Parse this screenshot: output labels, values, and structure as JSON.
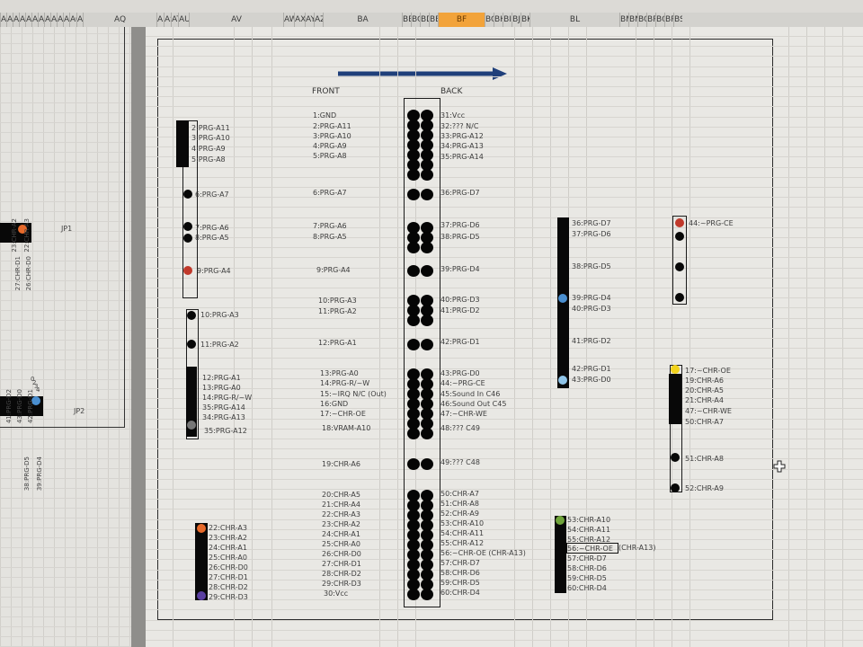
{
  "column_headers": [
    {
      "label": "AD"
    },
    {
      "label": "AE"
    },
    {
      "label": "AF"
    },
    {
      "label": "AG"
    },
    {
      "label": "AH"
    },
    {
      "label": "AI"
    },
    {
      "label": "AJ"
    },
    {
      "label": "AK"
    },
    {
      "label": "AL"
    },
    {
      "label": "AM"
    },
    {
      "label": "AN"
    },
    {
      "label": "AO"
    },
    {
      "label": "AP"
    },
    {
      "label": "AQ"
    },
    {
      "label": "AR"
    },
    {
      "label": "AS"
    },
    {
      "label": "AT"
    },
    {
      "label": "AU"
    },
    {
      "label": "AV"
    },
    {
      "label": "AW"
    },
    {
      "label": "AX"
    },
    {
      "label": "AY"
    },
    {
      "label": "AZ"
    },
    {
      "label": "BA"
    },
    {
      "label": "BB"
    },
    {
      "label": "BC"
    },
    {
      "label": "BD"
    },
    {
      "label": "BE"
    },
    {
      "label": "BF"
    },
    {
      "label": "BG"
    },
    {
      "label": "BH"
    },
    {
      "label": "BI"
    },
    {
      "label": "BJ"
    },
    {
      "label": "BK"
    },
    {
      "label": "BL"
    },
    {
      "label": "BM"
    },
    {
      "label": "BN"
    },
    {
      "label": "BO"
    },
    {
      "label": "BP"
    },
    {
      "label": "BQ"
    },
    {
      "label": "BR"
    },
    {
      "label": "BS"
    }
  ],
  "selected_column": "BF",
  "left_pane": {
    "jp1": "JP1",
    "jp2": "JP2",
    "rot_labels": [
      "22:CHR-A3",
      "23:CHR-A2",
      "26:CHR-D0",
      "27:CHR-D1",
      "42:PRG-D1",
      "43:PRG-D0",
      "41:PRG-D2",
      "38:PRG-D5",
      "39:PRG-D4"
    ],
    "digits": [
      "0",
      "2",
      "3",
      "4"
    ]
  },
  "main": {
    "front_header": "FRONT",
    "back_header": "BACK",
    "left_connector_labels": [
      "2:PRG-A11",
      "3:PRG-A10",
      "4:PRG-A9",
      "5:PRG-A8",
      "6:PRG-A7",
      "7:PRG-A6",
      "8:PRG-A5",
      "9:PRG-A4",
      "10:PRG-A3",
      "11:PRG-A2",
      "12:PRG-A1",
      "13:PRG-A0",
      "14:PRG-R/~W",
      "35:PRG-A14",
      "34:PRG-A13",
      "35:PRG-A12",
      "22:CHR-A3",
      "23:CHR-A2",
      "24:CHR-A1",
      "25:CHR-A0",
      "26:CHR-D0",
      "27:CHR-D1",
      "28:CHR-D2",
      "29:CHR-D3"
    ],
    "front_labels": [
      "1:GND",
      "2:PRG-A11",
      "3:PRG-A10",
      "4:PRG-A9",
      "5:PRG-A8",
      "6:PRG-A7",
      "7:PRG-A6",
      "8:PRG-A5",
      "9:PRG-A4",
      "10:PRG-A3",
      "11:PRG-A2",
      "12:PRG-A1",
      "13:PRG-A0",
      "14:PRG-R/~W",
      "15:~IRQ N/C (Out)",
      "16:GND",
      "17:~CHR-OE",
      "18:VRAM-A10",
      "19:CHR-A6",
      "20:CHR-A5",
      "21:CHR-A4",
      "22:CHR-A3",
      "23:CHR-A2",
      "24:CHR-A1",
      "25:CHR-A0",
      "26:CHR-D0",
      "27:CHR-D1",
      "28:CHR-D2",
      "29:CHR-D3",
      "30:Vcc"
    ],
    "back_labels": [
      "31:Vcc",
      "32:??? N/C",
      "33:PRG-A12",
      "34:PRG-A13",
      "35:PRG-A14",
      "36:PRG-D7",
      "37:PRG-D6",
      "38:PRG-D5",
      "39:PRG-D4",
      "40:PRG-D3",
      "41:PRG-D2",
      "42:PRG-D1",
      "43:PRG-D0",
      "44:~PRG-CE",
      "45:Sound In C46",
      "46:Sound Out C45",
      "47:~CHR-WE",
      "48:??? C49",
      "49:??? C48",
      "50:CHR-A7",
      "51:CHR-A8",
      "52:CHR-A9",
      "53:CHR-A10",
      "54:CHR-A11",
      "55:CHR-A12",
      "56:~CHR-OE (CHR-A13)",
      "57:CHR-D7",
      "58:CHR-D6",
      "59:CHR-D5",
      "60:CHR-D4"
    ],
    "right1_labels": [
      "36:PRG-D7",
      "37:PRG-D6",
      "38:PRG-D5",
      "39:PRG-D4",
      "40:PRG-D3",
      "41:PRG-D2",
      "42:PRG-D1",
      "43:PRG-D0"
    ],
    "right1b_labels": [
      "53:CHR-A10",
      "54:CHR-A11",
      "55:CHR-A12",
      "56:~CHR-OE",
      "57:CHR-D7",
      "58:CHR-D6",
      "59:CHR-D5",
      "60:CHR-D4"
    ],
    "right1b_extra": "(CHR-A13)",
    "right2_labels": [
      "44:~PRG-CE"
    ],
    "right2b_labels": [
      "17:~CHR-OE",
      "19:CHR-A6",
      "20:CHR-A5",
      "21:CHR-A4",
      "47:~CHR-WE",
      "50:CHR-A7",
      "51:CHR-A8",
      "52:CHR-A9"
    ]
  },
  "colors": {
    "pin_red": "#c0392b",
    "pin_orange": "#e6692a",
    "pin_blue": "#4a8fd0",
    "pin_lightblue": "#8fc4e8",
    "pin_yellow": "#f2d31c",
    "pin_green": "#6fa33a",
    "pin_purple": "#5a3fa0",
    "pin_grey": "#777777",
    "arrow": "#1f3f7a",
    "selected_col": "#f2a33a"
  }
}
